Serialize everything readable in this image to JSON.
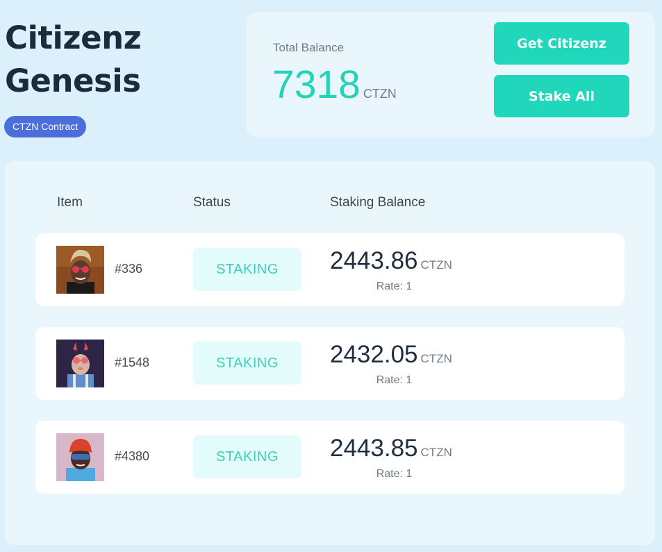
{
  "header": {
    "title_line1": "Citizenz",
    "title_line2": "Genesis",
    "contract_badge": "CTZN Contract"
  },
  "balance": {
    "label": "Total Balance",
    "value": "7318",
    "unit": "CTZN",
    "get_button": "Get Citizenz",
    "stake_all_button": "Stake All"
  },
  "table": {
    "headers": {
      "item": "Item",
      "status": "Status",
      "staking_balance": "Staking Balance"
    },
    "rows": [
      {
        "id": "#336",
        "status": "STAKING",
        "balance": "2443.86",
        "unit": "CTZN",
        "rate": "Rate: 1"
      },
      {
        "id": "#1548",
        "status": "STAKING",
        "balance": "2432.05",
        "unit": "CTZN",
        "rate": "Rate: 1"
      },
      {
        "id": "#4380",
        "status": "STAKING",
        "balance": "2443.85",
        "unit": "CTZN",
        "rate": "Rate: 1"
      }
    ]
  },
  "colors": {
    "accent": "#20d6bb",
    "badge": "#4c6edb",
    "background": "#dcf0fc",
    "card": "#e9f7fd"
  }
}
